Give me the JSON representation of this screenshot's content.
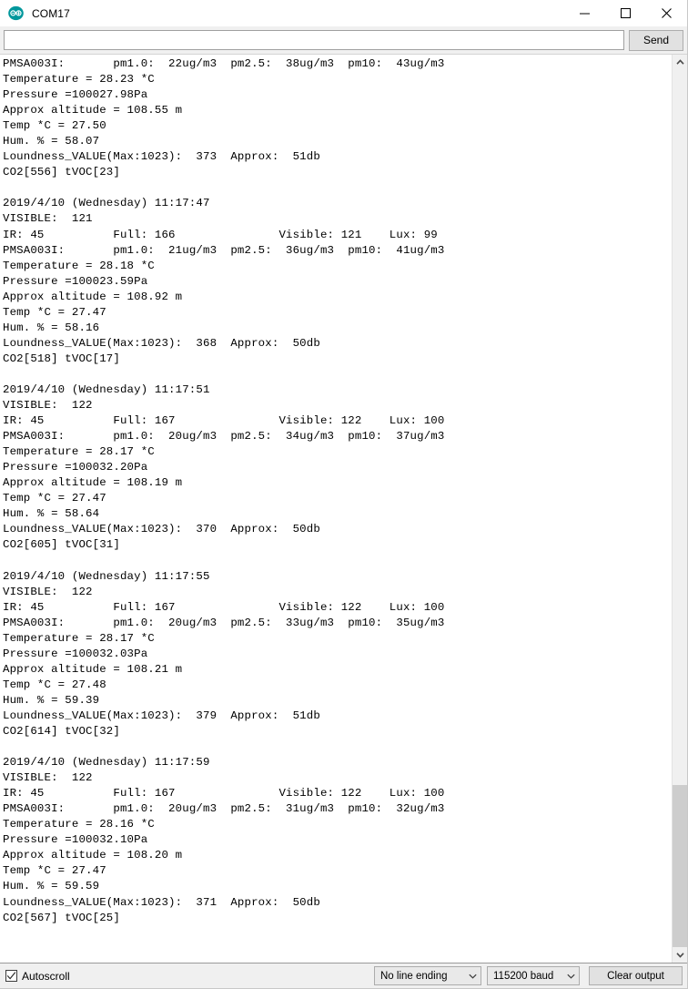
{
  "window": {
    "title": "COM17",
    "icon": "arduino-logo-icon",
    "controls": {
      "minimize": "minimize-icon",
      "maximize": "maximize-icon",
      "close": "close-icon"
    }
  },
  "toolbar": {
    "input_value": "",
    "input_placeholder": "",
    "send_label": "Send"
  },
  "console": {
    "lines": [
      "PMSA003I:\tpm1.0:  22ug/m3  pm2.5:  38ug/m3  pm10:  43ug/m3",
      "Temperature = 28.23 *C",
      "Pressure =100027.98Pa",
      "Approx altitude = 108.55 m",
      "Temp *C = 27.50",
      "Hum. % = 58.07",
      "Loundness_VALUE(Max:1023):  373  Approx:  51db",
      "CO2[556] tVOC[23]",
      "",
      "2019/4/10 (Wednesday) 11:17:47",
      "VISIBLE:  121",
      "IR: 45\t\tFull: 166\t\tVisible: 121\tLux: 99",
      "PMSA003I:\tpm1.0:  21ug/m3  pm2.5:  36ug/m3  pm10:  41ug/m3",
      "Temperature = 28.18 *C",
      "Pressure =100023.59Pa",
      "Approx altitude = 108.92 m",
      "Temp *C = 27.47",
      "Hum. % = 58.16",
      "Loundness_VALUE(Max:1023):  368  Approx:  50db",
      "CO2[518] tVOC[17]",
      "",
      "2019/4/10 (Wednesday) 11:17:51",
      "VISIBLE:  122",
      "IR: 45\t\tFull: 167\t\tVisible: 122\tLux: 100",
      "PMSA003I:\tpm1.0:  20ug/m3  pm2.5:  34ug/m3  pm10:  37ug/m3",
      "Temperature = 28.17 *C",
      "Pressure =100032.20Pa",
      "Approx altitude = 108.19 m",
      "Temp *C = 27.47",
      "Hum. % = 58.64",
      "Loundness_VALUE(Max:1023):  370  Approx:  50db",
      "CO2[605] tVOC[31]",
      "",
      "2019/4/10 (Wednesday) 11:17:55",
      "VISIBLE:  122",
      "IR: 45\t\tFull: 167\t\tVisible: 122\tLux: 100",
      "PMSA003I:\tpm1.0:  20ug/m3  pm2.5:  33ug/m3  pm10:  35ug/m3",
      "Temperature = 28.17 *C",
      "Pressure =100032.03Pa",
      "Approx altitude = 108.21 m",
      "Temp *C = 27.48",
      "Hum. % = 59.39",
      "Loundness_VALUE(Max:1023):  379  Approx:  51db",
      "CO2[614] tVOC[32]",
      "",
      "2019/4/10 (Wednesday) 11:17:59",
      "VISIBLE:  122",
      "IR: 45\t\tFull: 167\t\tVisible: 122\tLux: 100",
      "PMSA003I:\tpm1.0:  20ug/m3  pm2.5:  31ug/m3  pm10:  32ug/m3",
      "Temperature = 28.16 *C",
      "Pressure =100032.10Pa",
      "Approx altitude = 108.20 m",
      "Temp *C = 27.47",
      "Hum. % = 59.59",
      "Loundness_VALUE(Max:1023):  371  Approx:  50db",
      "CO2[567] tVOC[25]"
    ]
  },
  "scrollbar": {
    "up_arrow": "chevron-up-icon",
    "down_arrow": "chevron-down-icon",
    "thumb_top_pct": 81.5,
    "thumb_height_pct": 18.5
  },
  "statusbar": {
    "autoscroll_label": "Autoscroll",
    "autoscroll_checked": true,
    "line_ending_value": "No line ending",
    "baud_value": "115200 baud",
    "clear_label": "Clear output"
  },
  "colors": {
    "accent": "#00979c",
    "chrome": "#f0f0f0",
    "console_bg": "#ffffff",
    "text": "#000000",
    "scroll_thumb": "#cdcdcd"
  }
}
